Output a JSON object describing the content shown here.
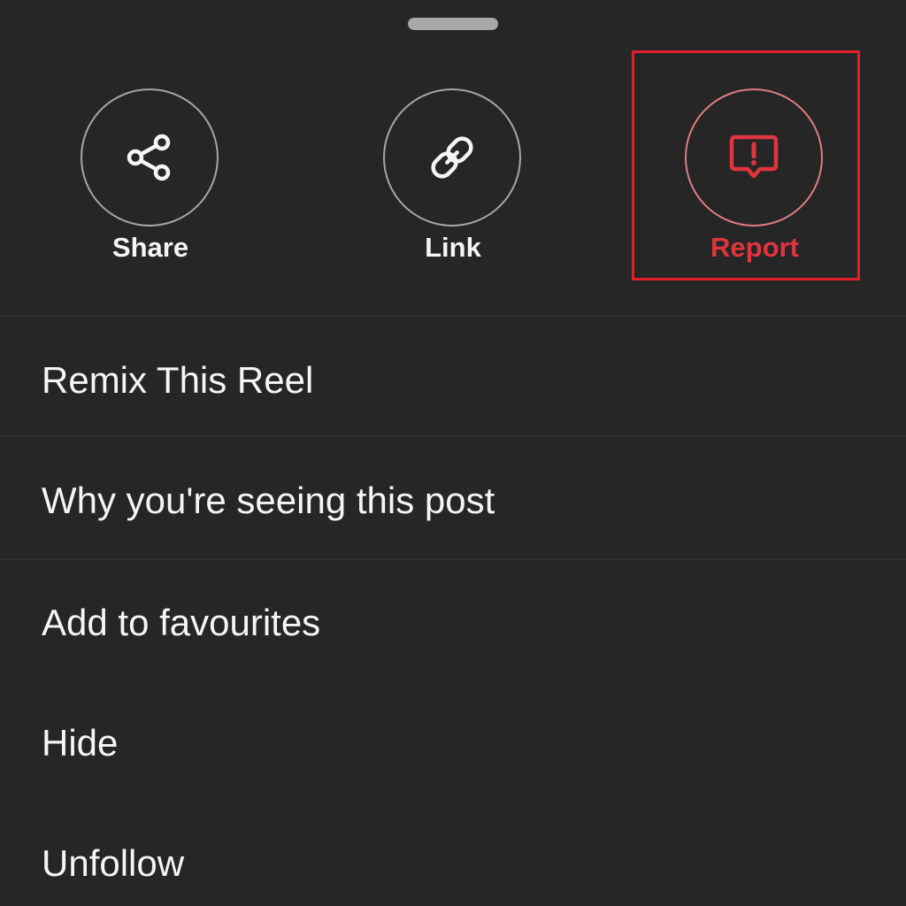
{
  "actions": {
    "share": {
      "label": "Share",
      "icon": "share-icon"
    },
    "link": {
      "label": "Link",
      "icon": "link-icon"
    },
    "report": {
      "label": "Report",
      "icon": "report-icon"
    }
  },
  "menu": {
    "items": [
      {
        "label": "Remix This Reel"
      },
      {
        "label": "Why you're seeing this post"
      },
      {
        "label": "Add to favourites"
      },
      {
        "label": "Hide"
      },
      {
        "label": "Unfollow"
      }
    ]
  },
  "colors": {
    "background": "#262626",
    "text": "#f5f5f5",
    "report_accent": "#e0353f",
    "highlight_box": "#e01f2b"
  }
}
